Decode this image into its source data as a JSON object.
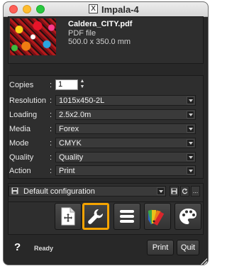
{
  "window": {
    "title": "Impala-4"
  },
  "file": {
    "name": "Caldera_CITY.pdf",
    "type": "PDF file",
    "size": "500.0 x 350.0 mm"
  },
  "params": {
    "copies": {
      "label": "Copies",
      "value": "1"
    },
    "resolution": {
      "label": "Resolution",
      "value": "1015x450-2L"
    },
    "loading": {
      "label": "Loading",
      "value": "2.5x2.0m"
    },
    "media": {
      "label": "Media",
      "value": "Forex"
    },
    "mode": {
      "label": "Mode",
      "value": "CMYK"
    },
    "quality": {
      "label": "Quality",
      "value": "Quality"
    },
    "action": {
      "label": "Action",
      "value": "Print"
    }
  },
  "config": {
    "value": "Default configuration",
    "more": "..."
  },
  "toolbar": {
    "tools": [
      {
        "icon": "add-page-icon"
      },
      {
        "icon": "wrench-icon",
        "selected": true
      },
      {
        "icon": "list-icon"
      },
      {
        "icon": "color-swatch-icon"
      },
      {
        "icon": "palette-icon"
      }
    ],
    "accent": "#f5a300"
  },
  "footer": {
    "help": "?",
    "status": "Ready",
    "print_label": "Print",
    "quit_label": "Quit"
  }
}
